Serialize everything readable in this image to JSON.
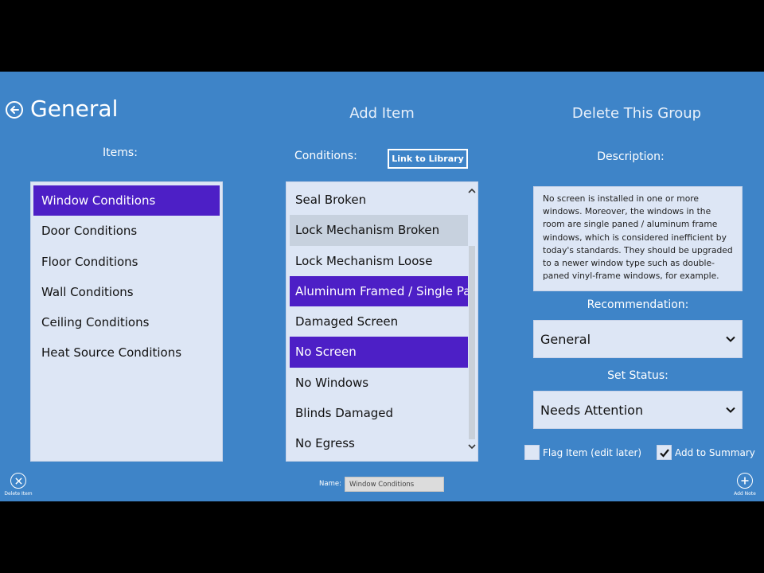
{
  "header": {
    "title": "General",
    "add_item": "Add Item",
    "delete_group": "Delete This Group"
  },
  "items_panel": {
    "label": "Items:",
    "items": [
      "Window Conditions",
      "Door Conditions",
      "Floor Conditions",
      "Wall Conditions",
      "Ceiling Conditions",
      "Heat Source Conditions"
    ],
    "selected_index": 0
  },
  "conditions_panel": {
    "label": "Conditions:",
    "link_button": "Link to Library",
    "items": [
      "Seal Broken",
      "Lock Mechanism Broken",
      "Lock Mechanism Loose",
      "Aluminum Framed / Single Pane",
      "Damaged Screen",
      "No Screen",
      "No Windows",
      "Blinds Damaged",
      "No Egress"
    ],
    "selected_indices": [
      3,
      5
    ],
    "hover_index": 1
  },
  "description": {
    "label": "Description:",
    "text": "No screen is installed in one or more windows. Moreover, the windows in the room are single paned / aluminum frame windows, which is considered inefficient by today's standards. They should be upgraded to a newer window type such as double-paned vinyl-frame windows, for example."
  },
  "recommendation": {
    "label": "Recommendation:",
    "value": "General"
  },
  "status": {
    "label": "Set Status:",
    "value": "Needs Attention"
  },
  "flags": {
    "flag_item_label": "Flag Item (edit later)",
    "flag_item_checked": false,
    "add_summary_label": "Add to Summary",
    "add_summary_checked": true
  },
  "appbar": {
    "delete_item_label": "Delete Item",
    "add_note_label": "Add Note",
    "name_label": "Name:",
    "name_value": "Window Conditions"
  },
  "colors": {
    "background": "#3e84c8",
    "panel": "#dde6f5",
    "selection": "#4d1fc6"
  }
}
